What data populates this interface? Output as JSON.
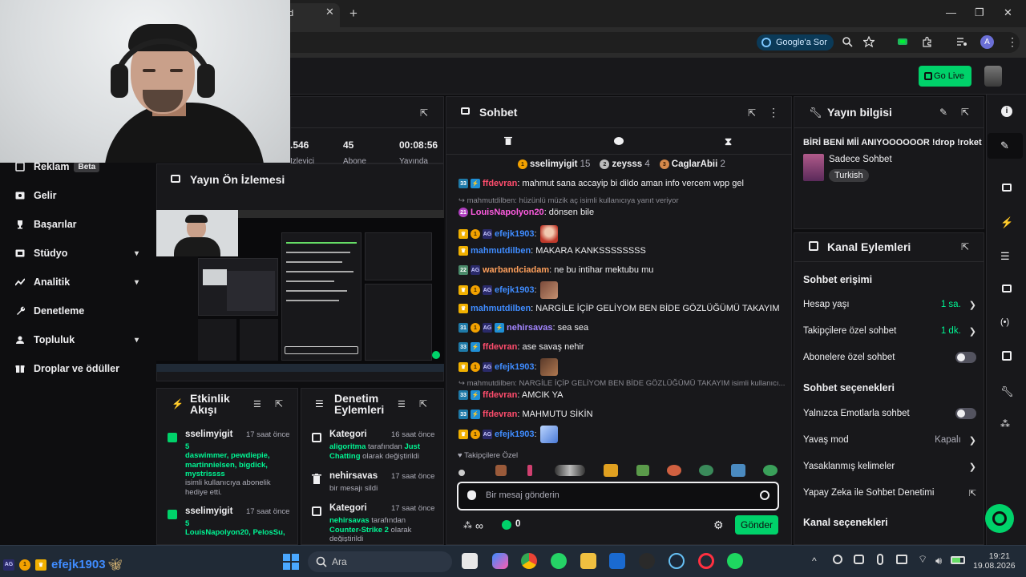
{
  "browser": {
    "tab_title": "d",
    "google_sor": "Google'a Sor",
    "profile_initial": "A"
  },
  "topnav": {
    "go_live": "Go Live"
  },
  "sidebar": {
    "items": [
      {
        "label": "Reklam",
        "badge": "Beta",
        "icon": "megaphone-icon"
      },
      {
        "label": "Gelir",
        "icon": "money-icon"
      },
      {
        "label": "Başarılar",
        "icon": "trophy-icon"
      },
      {
        "label": "Stüdyo",
        "icon": "studio-icon"
      },
      {
        "label": "Analitik",
        "icon": "chart-icon"
      },
      {
        "label": "Denetleme",
        "icon": "wrench-icon"
      },
      {
        "label": "Topluluk",
        "icon": "people-icon"
      },
      {
        "label": "Droplar ve ödüller",
        "icon": "gift-icon"
      }
    ]
  },
  "stats": {
    "viewers": ".546",
    "viewers_label": "Izleyici",
    "followers": "45",
    "followers_label": "Abone",
    "uptime": "00:08:56",
    "uptime_label": "Yayında"
  },
  "preview": {
    "title": "Yayın Ön İzlemesi"
  },
  "activity": {
    "title": "Etkinlik Akışı",
    "items": [
      {
        "user": "sselimyigit",
        "time": "17 saat önce",
        "count": "5",
        "names": "daswimmer, pewdiepie, martinnielsen, bigdick, mystrissss",
        "text": "isimli kullanıcıya abonelik hediye etti."
      },
      {
        "user": "sselimyigit",
        "time": "17 saat önce",
        "count": "5",
        "names": "LouisNapolyon20, PelosSu,",
        "text": ""
      }
    ]
  },
  "modlog": {
    "title": "Denetim Eylemleri",
    "items": [
      {
        "user": "Kategori",
        "time": "16 saat önce",
        "actor": "aligoritma",
        "text1": " tarafından ",
        "target": "Just Chatting",
        "text2": " olarak değiştirildi"
      },
      {
        "user": "nehirsavas",
        "time": "17 saat önce",
        "text": "bir mesajı sildi"
      },
      {
        "user": "Kategori",
        "time": "17 saat önce",
        "actor": "nehirsavas",
        "text1": " tarafından ",
        "target": "Counter-Strike 2",
        "text2": " olarak değiştirildi"
      }
    ]
  },
  "chat": {
    "title": "Sohbet",
    "leaders": [
      {
        "rank": "1",
        "name": "sselimyigit",
        "count": "15"
      },
      {
        "rank": "2",
        "name": "zeysss",
        "count": "4"
      },
      {
        "rank": "3",
        "name": "CaglarAbii",
        "count": "2"
      }
    ],
    "messages": [
      {
        "user": "ffdevran",
        "color": "#ff4d6d",
        "text": ": mahmut sana accayip bi dildo aman info vercem wpp gel"
      },
      {
        "reply": "mahmutdilben: hüzünlü müzik aç isimli kullanıcıya yanıt veriyor"
      },
      {
        "user": "LouisNapolyon20",
        "color": "#ff5ce1",
        "text": ": dönsen bile"
      },
      {
        "user": "efejk1903",
        "color": "#3f8cff",
        "text": ":"
      },
      {
        "user": "mahmutdilben",
        "color": "#3f8cff",
        "text": ": MAKARA KANKSSSSSSSS"
      },
      {
        "user": "warbandciadam",
        "color": "#ffa05c",
        "text": ": ne bu intihar mektubu mu"
      },
      {
        "user": "efejk1903",
        "color": "#3f8cff",
        "text": ":"
      },
      {
        "user": "mahmutdilben",
        "color": "#3f8cff",
        "text": ": NARGİLE İÇİP GELİYOM BEN BİDE GÖZLÜĞÜMÜ TAKAYIM"
      },
      {
        "user": "nehirsavas",
        "color": "#a385ff",
        "text": ": sea sea"
      },
      {
        "user": "ffdevran",
        "color": "#ff4d6d",
        "text": ": ase savaş nehir"
      },
      {
        "user": "efejk1903",
        "color": "#3f8cff",
        "text": ":"
      },
      {
        "reply": "mahmutdilben: NARGİLE İÇİP GELİYOM BEN BİDE GÖZLÜĞÜMÜ TAKAYIM isimli kullanıcı..."
      },
      {
        "user": "ffdevran",
        "color": "#ff4d6d",
        "text": ": AMCIK YA"
      },
      {
        "user": "ffdevran",
        "color": "#ff4d6d",
        "text": ": MAHMUTU SİKİN"
      },
      {
        "user": "efejk1903",
        "color": "#3f8cff",
        "text": ":"
      }
    ],
    "follower_only": "Takipçilere Özel",
    "placeholder": "Bir mesaj gönderin",
    "points": "0",
    "send": "Gönder"
  },
  "info": {
    "title": "Yayın bilgisi",
    "stream_title": "BİRİ BENİ Mİİ ANIYOOOOOOR !drop !roket",
    "category": "Sadece Sohbet",
    "tag": "Turkish"
  },
  "actions": {
    "title": "Kanal Eylemleri",
    "section1": "Sohbet erişimi",
    "rows1": [
      {
        "label": "Hesap yaşı",
        "value": "1 sa."
      },
      {
        "label": "Takipçilere özel sohbet",
        "value": "1 dk."
      },
      {
        "label": "Abonelere özel sohbet",
        "value": ""
      }
    ],
    "section2": "Sohbet seçenekleri",
    "rows2": [
      {
        "label": "Yalnızca Emotlarla sohbet",
        "value": ""
      },
      {
        "label": "Yavaş mod",
        "value": "Kapalı"
      },
      {
        "label": "Yasaklanmış kelimeler",
        "value": ""
      },
      {
        "label": "Yapay Zeka ile Sohbet Denetimi",
        "value": ""
      }
    ],
    "section3": "Kanal seçenekleri"
  },
  "overlay": {
    "username": "efejk1903"
  },
  "taskbar": {
    "search": "Ara",
    "time": "19:21",
    "date": "19.08.2026"
  },
  "colors": {
    "accent": "#00d26a",
    "bg": "#0e0e10",
    "panel": "#18181b"
  }
}
